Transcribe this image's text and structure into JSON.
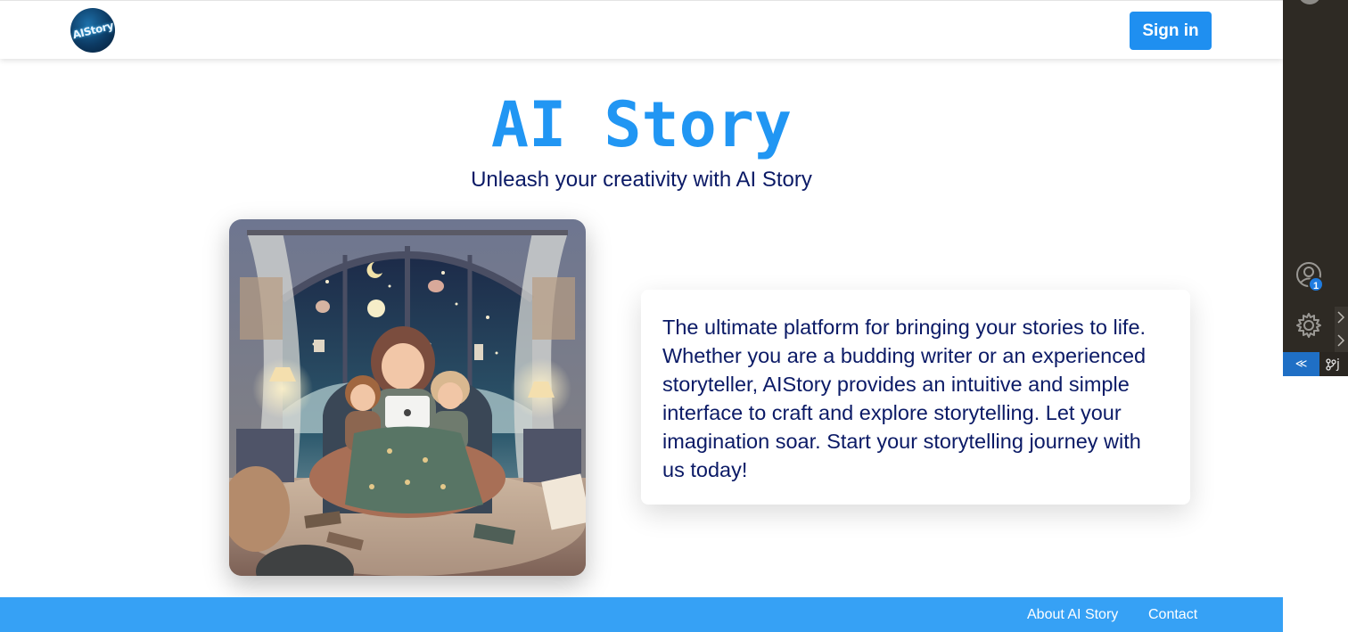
{
  "header": {
    "logo_text": "AIStory",
    "sign_in_label": "Sign in"
  },
  "hero": {
    "title": "AI Story",
    "subtitle": "Unleash your creativity with AI Story"
  },
  "description": "The ultimate platform for bringing your stories to life. Whether you are a budding writer or an experienced storyteller, AIStory provides an intuitive and simple interface to craft and explore storytelling. Let your imagination soar. Start your storytelling journey with us today!",
  "footer": {
    "links": [
      "About AI Story",
      "Contact"
    ]
  },
  "editor_sidebar": {
    "account_badge": "1",
    "branch_label": "j",
    "remote_icon": "remote-icon",
    "icons": [
      "account-icon",
      "gear-icon",
      "source-control-icon"
    ]
  },
  "colors": {
    "accent": "#2196f3",
    "sign_in_button": "#1f8ff0",
    "footer": "#36a1f5",
    "text_dark": "#0b1a66"
  }
}
